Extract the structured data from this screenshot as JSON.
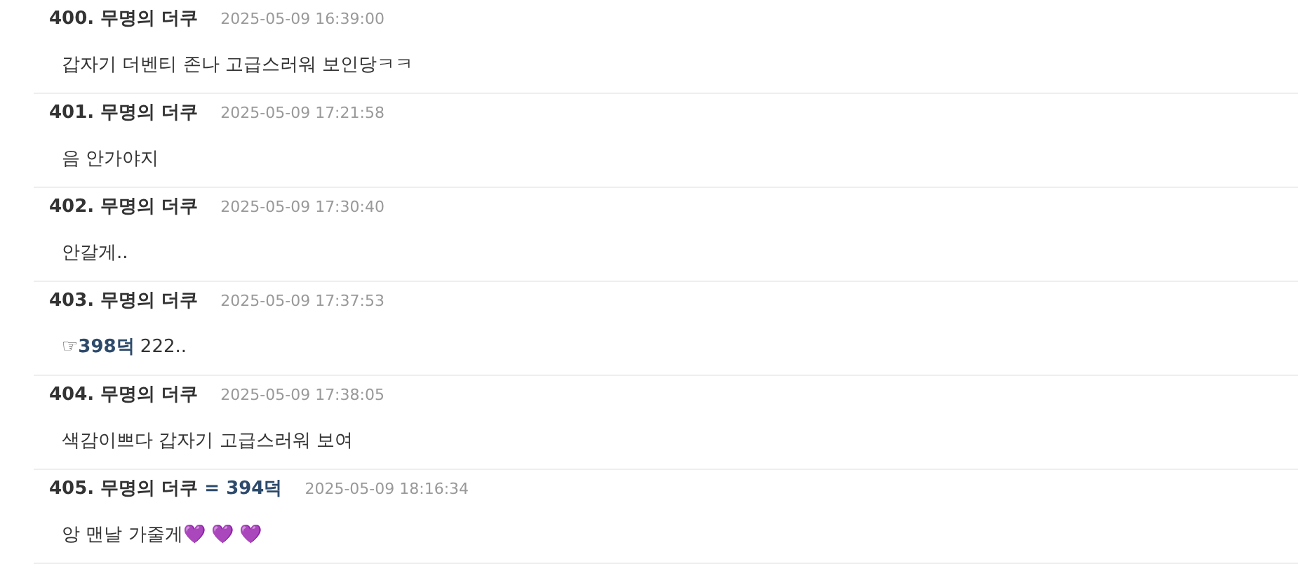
{
  "comments": [
    {
      "author": "400. 무명의 더쿠",
      "time": "2025-05-09 16:39:00",
      "text": "갑자기 더벤티 존나 고급스러워 보인당ㅋㅋ"
    },
    {
      "author": "401. 무명의 더쿠",
      "time": "2025-05-09 17:21:58",
      "text": "음 안가야지"
    },
    {
      "author": "402. 무명의 더쿠",
      "time": "2025-05-09 17:30:40",
      "text": "안갈게.."
    },
    {
      "author": "403. 무명의 더쿠",
      "time": "2025-05-09 17:37:53",
      "text": "☞**398덕** 222.."
    },
    {
      "author": "404. 무명의 더쿠",
      "time": "2025-05-09 17:38:05",
      "text": "색감이쁘다 갑자기 고급스러워 보여"
    },
    {
      "author": "405. 무명의 더쿠 **= 394덕**",
      "time": "2025-05-09 18:16:34",
      "text": "앙 맨날 가줄게💜 💜 💜"
    }
  ]
}
